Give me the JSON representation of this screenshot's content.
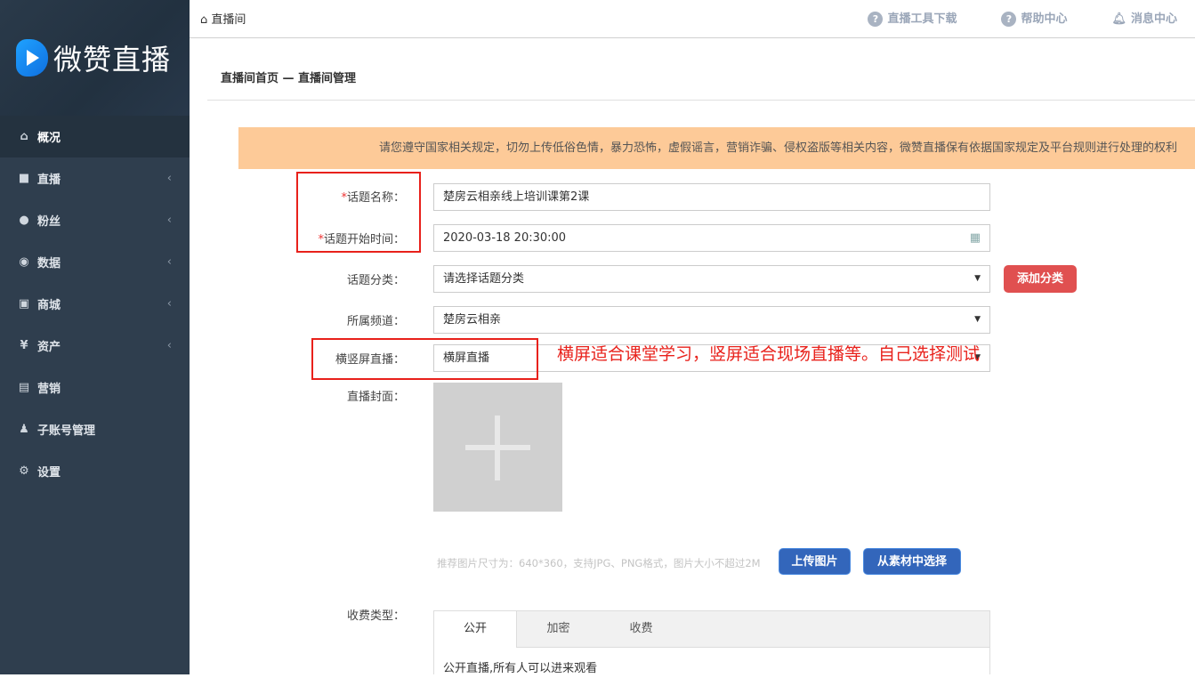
{
  "brand": {
    "name": "微赞直播"
  },
  "sidebar": {
    "items": [
      {
        "label": "概况",
        "icon": "home-icon",
        "active": true
      },
      {
        "label": "直播",
        "icon": "video-camera-icon",
        "submenu": true
      },
      {
        "label": "粉丝",
        "icon": "user-icon",
        "submenu": true
      },
      {
        "label": "数据",
        "icon": "eye-icon",
        "submenu": true
      },
      {
        "label": "商城",
        "icon": "shopping-bag-icon",
        "submenu": true
      },
      {
        "label": "资产",
        "icon": "yen-icon",
        "submenu": true
      },
      {
        "label": "营销",
        "icon": "ticket-icon"
      },
      {
        "label": "子账号管理",
        "icon": "user-key-icon"
      },
      {
        "label": "设置",
        "icon": "gear-icon"
      }
    ]
  },
  "topbar": {
    "breadcrumb": "直播间",
    "links": [
      {
        "label": "直播工具下载",
        "icon": "question-icon"
      },
      {
        "label": "帮助中心",
        "icon": "question-icon"
      },
      {
        "label": "消息中心",
        "icon": "bell-icon"
      }
    ]
  },
  "page": {
    "title": "直播间首页 — 直播间管理"
  },
  "notice": "请您遵守国家相关规定，切勿上传低俗色情，暴力恐怖，虚假谣言，营销诈骗、侵权盗版等相关内容，微赞直播保有依据国家规定及平台规则进行处理的权利",
  "form": {
    "topic_name": {
      "label": "话题名称：",
      "value": "楚房云相亲线上培训课第2课",
      "required": "*"
    },
    "start_time": {
      "label": "话题开始时间：",
      "value": "2020-03-18 20:30:00",
      "required": "*"
    },
    "category": {
      "label": "话题分类：",
      "value": "请选择话题分类",
      "add_button": "添加分类"
    },
    "channel": {
      "label": "所属频道：",
      "value": "楚房云相亲"
    },
    "orientation": {
      "label": "横竖屏直播：",
      "value": "横屏直播"
    },
    "cover": {
      "label": "直播封面：",
      "hint": "推荐图片尺寸为：640*360，支持JPG、PNG格式，图片大小不超过2M",
      "upload_button": "上传图片",
      "library_button": "从素材中选择"
    },
    "fee_type": {
      "label": "收费类型：",
      "tabs": [
        "公开",
        "加密",
        "收费"
      ],
      "active_tab": 0,
      "description": "公开直播,所有人可以进来观看"
    }
  },
  "annotation": "横屏适合课堂学习，竖屏适合现场直播等。自己选择测试",
  "colors": {
    "sidebar": "#2f3e4e",
    "notice": "#fdca98",
    "primary_button": "#3366bb",
    "danger_button": "#e05050",
    "annotation": "#e8211b"
  }
}
